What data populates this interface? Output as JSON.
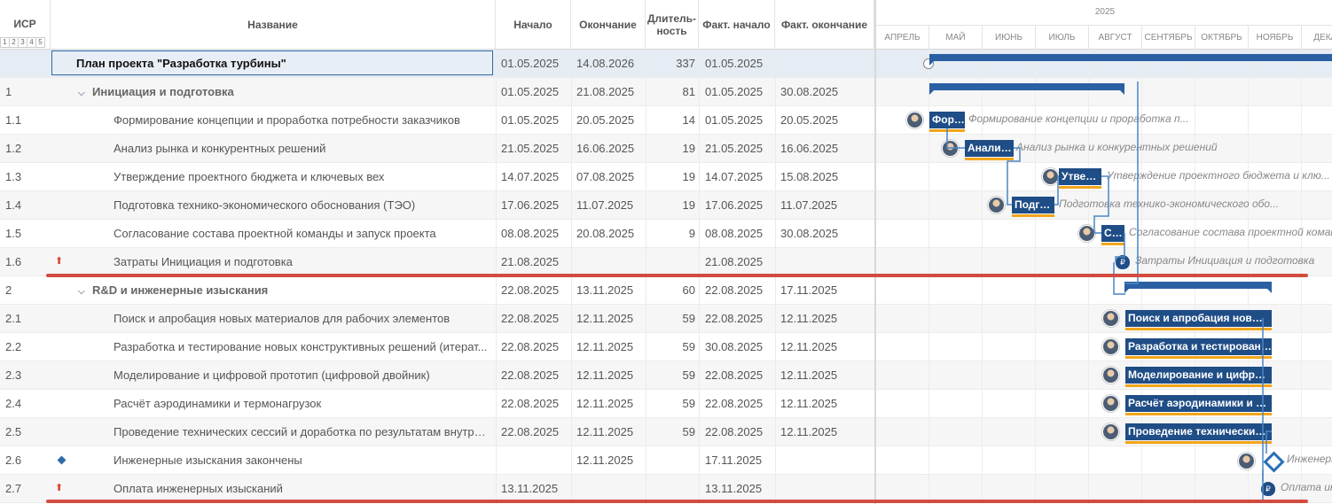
{
  "header": {
    "wbs": "ИСР",
    "levels": [
      "1",
      "2",
      "3",
      "4",
      "5"
    ],
    "name": "Название",
    "start": "Начало",
    "end": "Окончание",
    "duration": "Длитель-\nность",
    "fact_start": "Факт. начало",
    "fact_end": "Факт. окончание"
  },
  "timeline": {
    "year": "2025",
    "months": [
      "АПРЕЛЬ",
      "МАЙ",
      "ИЮНЬ",
      "ИЮЛЬ",
      "АВГУСТ",
      "СЕНТЯБРЬ",
      "ОКТЯБРЬ",
      "НОЯБРЬ",
      "ДЕКАБ"
    ]
  },
  "rows": [
    {
      "wbs": "",
      "name": "План проекта \"Разработка турбины\"",
      "start": "01.05.2025",
      "end": "14.08.2026",
      "dur": "337",
      "fs": "01.05.2025",
      "fe": ""
    },
    {
      "wbs": "1",
      "name": "Инициация и подготовка",
      "start": "01.05.2025",
      "end": "21.08.2025",
      "dur": "81",
      "fs": "01.05.2025",
      "fe": "30.08.2025"
    },
    {
      "wbs": "1.1",
      "name": "Формирование концепции и проработка потребности заказчиков",
      "start": "01.05.2025",
      "end": "20.05.2025",
      "dur": "14",
      "fs": "01.05.2025",
      "fe": "20.05.2025"
    },
    {
      "wbs": "1.2",
      "name": "Анализ рынка и конкурентных решений",
      "start": "21.05.2025",
      "end": "16.06.2025",
      "dur": "19",
      "fs": "21.05.2025",
      "fe": "16.06.2025"
    },
    {
      "wbs": "1.3",
      "name": "Утверждение проектного бюджета и ключевых вех",
      "start": "14.07.2025",
      "end": "07.08.2025",
      "dur": "19",
      "fs": "14.07.2025",
      "fe": "15.08.2025"
    },
    {
      "wbs": "1.4",
      "name": "Подготовка технико-экономического обоснования (ТЭО)",
      "start": "17.06.2025",
      "end": "11.07.2025",
      "dur": "19",
      "fs": "17.06.2025",
      "fe": "11.07.2025"
    },
    {
      "wbs": "1.5",
      "name": "Согласование состава проектной команды и запуск проекта",
      "start": "08.08.2025",
      "end": "20.08.2025",
      "dur": "9",
      "fs": "08.08.2025",
      "fe": "30.08.2025"
    },
    {
      "wbs": "1.6",
      "name": "Затраты Инициация и подготовка",
      "start": "21.08.2025",
      "end": "",
      "dur": "",
      "fs": "21.08.2025",
      "fe": ""
    },
    {
      "wbs": "2",
      "name": "R&D и инженерные изыскания",
      "start": "22.08.2025",
      "end": "13.11.2025",
      "dur": "60",
      "fs": "22.08.2025",
      "fe": "17.11.2025"
    },
    {
      "wbs": "2.1",
      "name": "Поиск и апробация новых материалов для рабочих элементов",
      "start": "22.08.2025",
      "end": "12.11.2025",
      "dur": "59",
      "fs": "22.08.2025",
      "fe": "12.11.2025"
    },
    {
      "wbs": "2.2",
      "name": "Разработка и тестирование новых конструктивных решений (итерат...",
      "start": "22.08.2025",
      "end": "12.11.2025",
      "dur": "59",
      "fs": "30.08.2025",
      "fe": "12.11.2025"
    },
    {
      "wbs": "2.3",
      "name": "Моделирование и цифровой прототип (цифровой двойник)",
      "start": "22.08.2025",
      "end": "12.11.2025",
      "dur": "59",
      "fs": "22.08.2025",
      "fe": "12.11.2025"
    },
    {
      "wbs": "2.4",
      "name": "Расчёт аэродинамики и термонагрузок",
      "start": "22.08.2025",
      "end": "12.11.2025",
      "dur": "59",
      "fs": "22.08.2025",
      "fe": "12.11.2025"
    },
    {
      "wbs": "2.5",
      "name": "Проведение технических сессий и доработка по результатам внутре...",
      "start": "22.08.2025",
      "end": "12.11.2025",
      "dur": "59",
      "fs": "22.08.2025",
      "fe": "12.11.2025"
    },
    {
      "wbs": "2.6",
      "name": "Инженерные изыскания закончены",
      "start": "",
      "end": "12.11.2025",
      "dur": "",
      "fs": "17.11.2025",
      "fe": ""
    },
    {
      "wbs": "2.7",
      "name": "Оплата инженерных изысканий",
      "start": "13.11.2025",
      "end": "",
      "dur": "",
      "fs": "13.11.2025",
      "fe": ""
    }
  ],
  "bars": {
    "b1_1": "Форм...",
    "b1_2": "Анализ ...",
    "b1_3": "Утверж...",
    "b1_4": "Подгот...",
    "b1_5": "Со...",
    "b2_1": "Поиск и апробация новых ...",
    "b2_2": "Разработка и тестирование...",
    "b2_3": "Моделирование и цифрово...",
    "b2_4": "Расчёт аэродинамики и тер...",
    "b2_5": "Проведение технических с..."
  },
  "bar_labels": {
    "l1_1": "Формирование концепции и проработка п...",
    "l1_2": "Анализ рынка и конкурентных решений",
    "l1_3": "Утверждение проектного бюджета и клю...",
    "l1_4": "Подготовка технико-экономического обо...",
    "l1_5": "Согласование состава проектной коман...",
    "l1_6": "Затраты Инициация и подготовка",
    "l2_6": "Инженерн...",
    "l2_7": "Оплата ин..."
  },
  "icons": {
    "cost": "money-bag-icon",
    "priority": "up-arrow-icon",
    "milestone": "diamond-icon"
  },
  "colors": {
    "accent": "#1f4d86",
    "progress": "#f2a51a",
    "highlight": "#d24c3f"
  }
}
